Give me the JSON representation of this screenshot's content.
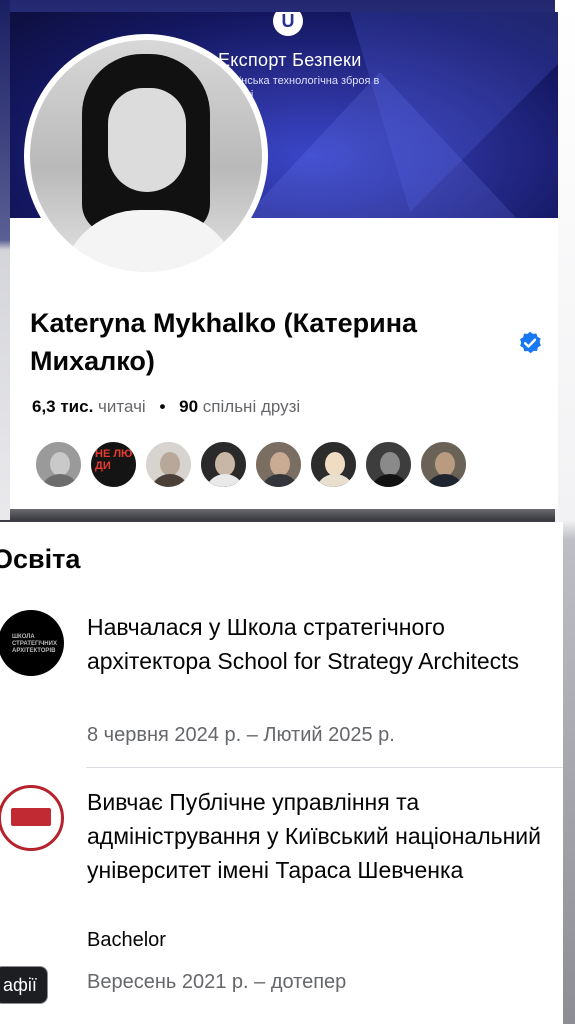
{
  "cover": {
    "logo_letter": "U",
    "title": "Експорт Безпеки",
    "subtitle": "аїнська технологічна зброя в світі"
  },
  "profile": {
    "name": "Kateryna Mykhalko (Катерина Михалко)",
    "verified": true,
    "followers_count": "6,3 тис.",
    "followers_label": "читачі",
    "separator": "•",
    "mutual_count": "90",
    "mutual_label": "спільні друзі",
    "mutual_friends_text": "НЕ ЛЮ ДИ"
  },
  "education": {
    "section_title": "Освіта",
    "items": [
      {
        "title": "Навчалася у Школа стратегічного архітектора School for Strategy Architects",
        "dates": "8 червня 2024 р. – Лютий 2025 р.",
        "logo_text": "ШКОЛА СТРАТЕГІЧНИХ АРХІТЕКТОРІВ"
      },
      {
        "title": "Вивчає Публічне управління та адміністрування у Київський національний університет імені Тараса Шевченка",
        "degree": "Bachelor",
        "dates": "Вересень 2021 р. – дотепер"
      }
    ]
  },
  "floating_chip": {
    "label": "афії"
  },
  "colors": {
    "verified_blue": "#1877f2",
    "secondary_text": "#65676b",
    "primary_text": "#050505"
  }
}
